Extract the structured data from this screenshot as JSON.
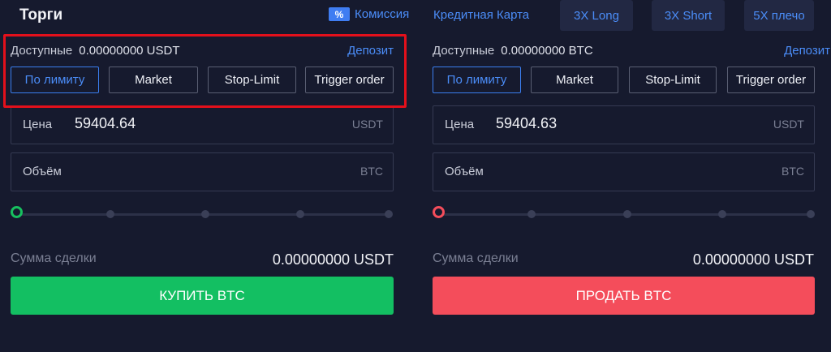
{
  "header": {
    "title": "Торги",
    "commission_icon": "%",
    "commission_label": "Комиссия",
    "card_label": "Кредитная Карта",
    "long_label": "3X Long",
    "short_label": "3X Short",
    "leverage_label": "5X плечо"
  },
  "buy_panel": {
    "available_label": "Доступные",
    "available_value": "0.00000000 USDT",
    "deposit_label": "Депозит",
    "order_types": [
      "По лимиту",
      "Market",
      "Stop-Limit",
      "Trigger order"
    ],
    "active_order_type": 0,
    "price_label": "Цена",
    "price_value": "59404.64",
    "price_unit": "USDT",
    "volume_label": "Объём",
    "volume_unit": "BTC",
    "slider_value_percent": 0,
    "sum_label": "Сумма сделки",
    "sum_value": "0.00000000 USDT",
    "action_label": "КУПИТЬ BTC"
  },
  "sell_panel": {
    "available_label": "Доступные",
    "available_value": "0.00000000 BTC",
    "deposit_label": "Депозит",
    "order_types": [
      "По лимиту",
      "Market",
      "Stop-Limit",
      "Trigger order"
    ],
    "active_order_type": 0,
    "price_label": "Цена",
    "price_value": "59404.63",
    "price_unit": "USDT",
    "volume_label": "Объём",
    "volume_unit": "BTC",
    "slider_value_percent": 0,
    "sum_label": "Сумма сделки",
    "sum_value": "0.00000000 USDT",
    "action_label": "ПРОДАТЬ BTC"
  },
  "colors": {
    "background": "#161a2e",
    "accent": "#4b8df8",
    "buy": "#13bf62",
    "sell": "#f44d5b",
    "highlight": "#e3101b"
  }
}
